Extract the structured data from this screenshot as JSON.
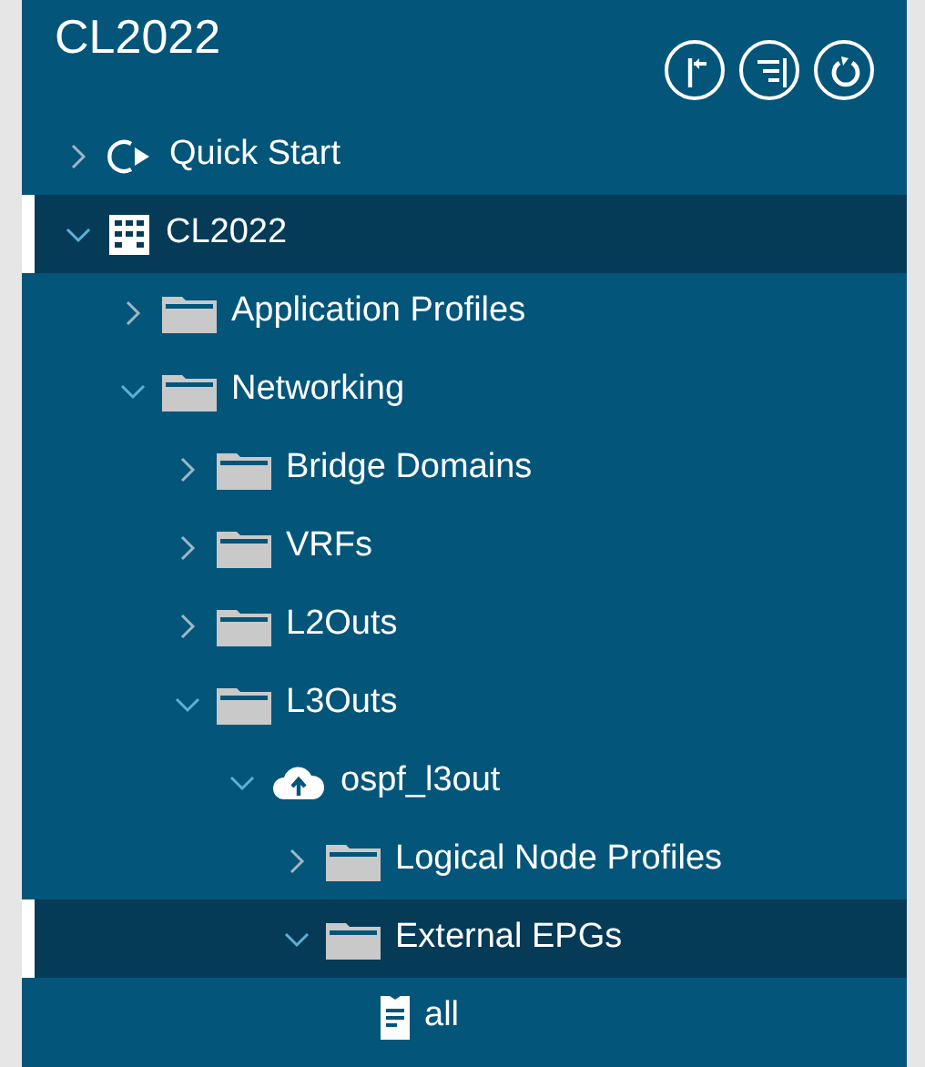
{
  "header": {
    "title": "CL2022"
  },
  "toolbar": [
    {
      "kind": "collapse"
    },
    {
      "kind": "filter"
    },
    {
      "kind": "refresh"
    }
  ],
  "tree": [
    {
      "label": "Quick Start",
      "kind": "quickstart",
      "expanded": false,
      "selected": false
    },
    {
      "label": "CL2022",
      "kind": "tenant",
      "expanded": true,
      "selected": true,
      "children": [
        {
          "label": "Application Profiles",
          "kind": "folder",
          "expanded": false,
          "selected": false
        },
        {
          "label": "Networking",
          "kind": "folder",
          "expanded": true,
          "selected": false,
          "children": [
            {
              "label": "Bridge Domains",
              "kind": "folder",
              "expanded": false,
              "selected": false
            },
            {
              "label": "VRFs",
              "kind": "folder",
              "expanded": false,
              "selected": false
            },
            {
              "label": "L2Outs",
              "kind": "folder",
              "expanded": false,
              "selected": false
            },
            {
              "label": "L3Outs",
              "kind": "folder",
              "expanded": true,
              "selected": false,
              "children": [
                {
                  "label": "ospf_l3out",
                  "kind": "cloud",
                  "expanded": true,
                  "selected": false,
                  "children": [
                    {
                      "label": "Logical Node Profiles",
                      "kind": "folder",
                      "expanded": false,
                      "selected": false
                    },
                    {
                      "label": "External EPGs",
                      "kind": "folder",
                      "expanded": true,
                      "selected": true,
                      "children": [
                        {
                          "label": "all",
                          "kind": "epg",
                          "selected": false
                        }
                      ]
                    }
                  ]
                }
              ]
            }
          ]
        }
      ]
    }
  ]
}
